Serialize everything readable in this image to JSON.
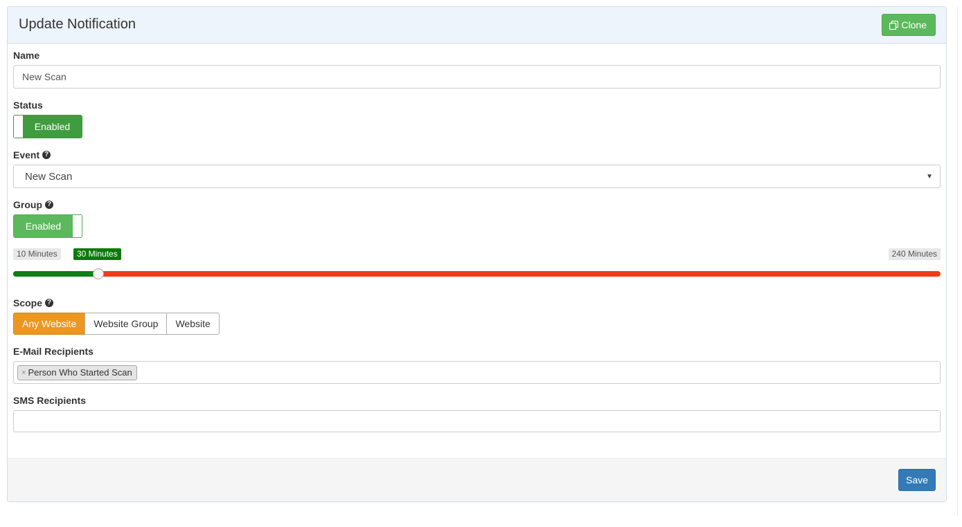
{
  "header": {
    "title": "Update Notification",
    "clone_label": "Clone"
  },
  "name": {
    "label": "Name",
    "value": "New Scan"
  },
  "status": {
    "label": "Status",
    "toggle_label": "Enabled"
  },
  "event": {
    "label": "Event",
    "selected": "New Scan"
  },
  "group": {
    "label": "Group",
    "toggle_label": "Enabled",
    "slider": {
      "min_label": "10 Minutes",
      "value_label": "30 Minutes",
      "max_label": "240 Minutes",
      "min": 10,
      "max": 240,
      "value": 30
    }
  },
  "scope": {
    "label": "Scope",
    "options": [
      "Any Website",
      "Website Group",
      "Website"
    ],
    "selected": "Any Website"
  },
  "email_recipients": {
    "label": "E-Mail Recipients",
    "tags": [
      "Person Who Started Scan"
    ]
  },
  "sms_recipients": {
    "label": "SMS Recipients",
    "value": ""
  },
  "footer": {
    "save_label": "Save"
  },
  "colors": {
    "slider_fill": "#0f7f17",
    "slider_rest": "#ee3b1a",
    "scope_active": "#ec971f",
    "save_button": "#337ab7"
  }
}
